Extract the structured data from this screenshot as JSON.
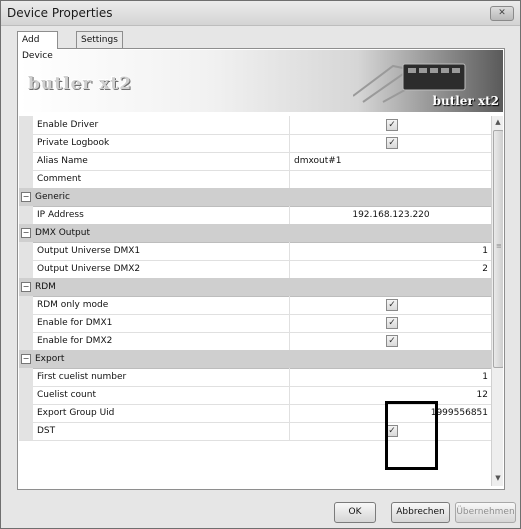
{
  "window": {
    "title": "Device Properties",
    "close_label": "✕"
  },
  "tabs": [
    {
      "label": "Add Device"
    },
    {
      "label": "Settings"
    }
  ],
  "banner": {
    "left_logo": "butler xt2",
    "right_logo": "butler xt2"
  },
  "grid": {
    "rows": [
      {
        "name": "Enable Driver",
        "checked": true
      },
      {
        "name": "Private Logbook",
        "checked": true
      },
      {
        "name": "Alias Name",
        "value": "dmxout#1"
      },
      {
        "name": "Comment",
        "value": ""
      },
      {
        "group": "Generic"
      },
      {
        "name": "IP Address",
        "value": "192.168.123.220"
      },
      {
        "group": "DMX Output"
      },
      {
        "name": "Output Universe DMX1",
        "value": "1"
      },
      {
        "name": "Output Universe DMX2",
        "value": "2"
      },
      {
        "group": "RDM"
      },
      {
        "name": "RDM only mode",
        "checked": true
      },
      {
        "name": "Enable for DMX1",
        "checked": true
      },
      {
        "name": "Enable for DMX2",
        "checked": true
      },
      {
        "group": "Export"
      },
      {
        "name": "First cuelist number",
        "value": "1"
      },
      {
        "name": "Cuelist count",
        "value": "12"
      },
      {
        "name": "Export Group Uid",
        "value": "1999556851"
      },
      {
        "name": "DST",
        "checked": true
      }
    ]
  },
  "buttons": {
    "ok": "OK",
    "cancel": "Abbrechen",
    "apply": "Übernehmen"
  }
}
